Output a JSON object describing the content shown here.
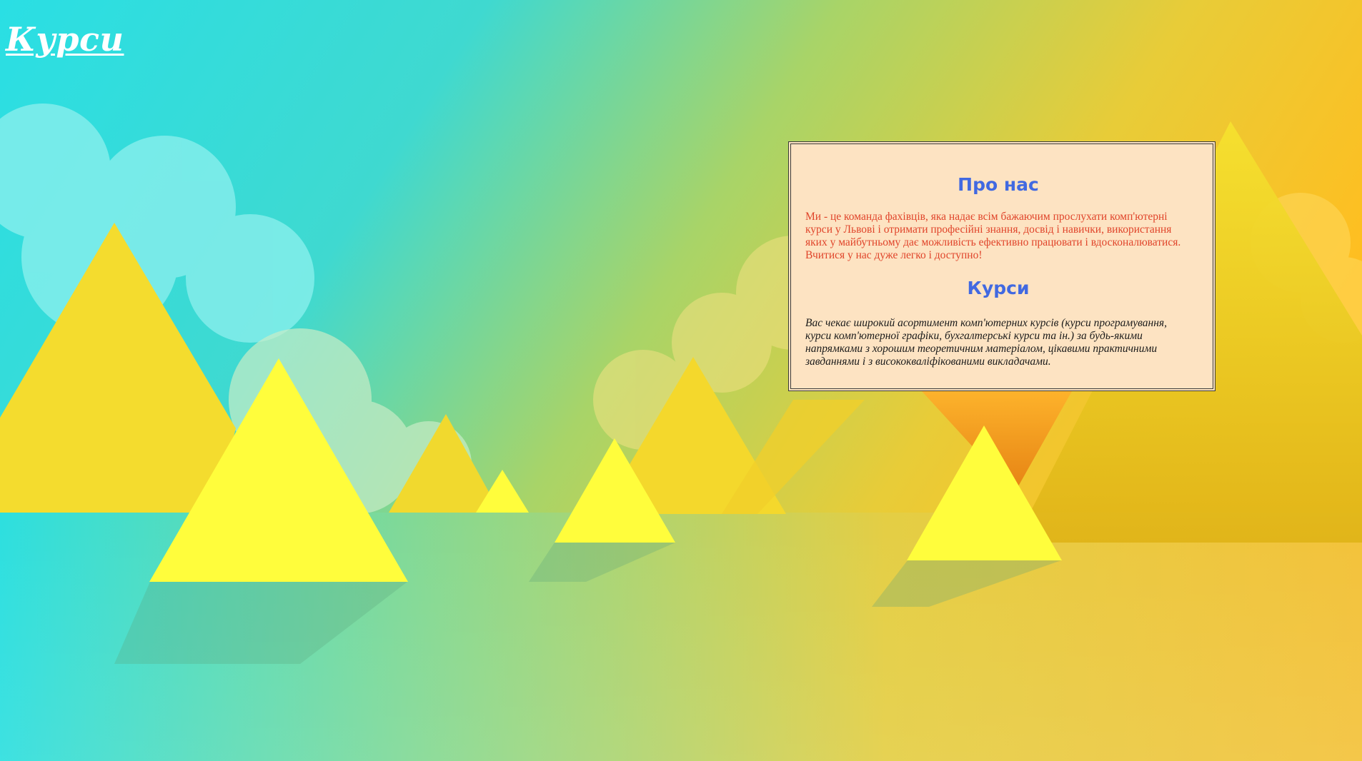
{
  "header": {
    "title": "Курси"
  },
  "about": {
    "heading": "Про нас",
    "text": "Ми - це команда фахівців, яка надає всім бажаючим прослухати комп'ютерні курси у Львові і отримати професійні знання, досвід і навички, використання яких у майбутньому дає можливість ефективно працювати і вдосконалюватися. Вчитися у нас дуже легко і доступно!"
  },
  "courses": {
    "heading": "Курси",
    "text": "Вас чекає широкий асортимент комп'ютерних курсів (курси програмування, курси комп'ютерної графіки, бухгалтерські курси та ін.) за будь-якими напрямками з хорошим теоретичним матеріалом, цікавими практичними завданнями і з висококваліфікованими викладачами."
  },
  "colors": {
    "sky_left": "#2adfe4",
    "sky_right": "#ffbe20",
    "box_background": "#fde3c2",
    "heading": "#4169e1",
    "about_text": "#e0442a"
  }
}
